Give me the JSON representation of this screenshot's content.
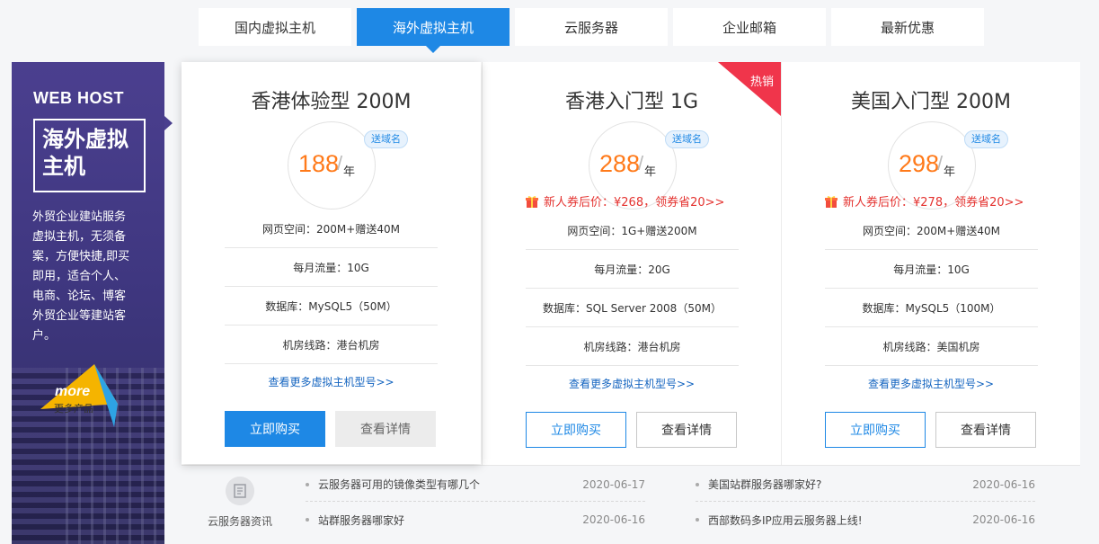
{
  "tabs": [
    "国内虚拟主机",
    "海外虚拟主机",
    "云服务器",
    "企业邮箱",
    "最新优惠"
  ],
  "active_tab": 1,
  "colors": {
    "accent": "#1e88e5",
    "price": "#ff7a1a",
    "coupon": "#e4322f",
    "banner": "#443b88"
  },
  "banner": {
    "en_title": "WEB HOST",
    "cn_title_line1": "海外虚拟",
    "cn_title_line2": "主机",
    "desc_lines": [
      "外贸企业建站服务",
      "虚拟主机，无须备",
      "案，方便快捷,即买",
      "即用，适合个人、",
      "电商、论坛、博客",
      "外贸企业等建站客",
      "户。"
    ],
    "more_en": "more",
    "more_cn": "更多产品"
  },
  "cards": [
    {
      "title": "香港体验型 200M",
      "price": "188",
      "slash": "/",
      "unit": "年",
      "tag": "送域名",
      "coupon": "",
      "specs": [
        "网页空间：200M+赠送40M",
        "每月流量：10G",
        "数据库：MySQL5（50M）",
        "机房线路：港台机房"
      ],
      "more_link": "查看更多虚拟主机型号>>",
      "buy": "立即购买",
      "detail": "查看详情"
    },
    {
      "title": "香港入门型 1G",
      "price": "288",
      "slash": "/",
      "unit": "年",
      "tag": "送域名",
      "coupon": "新人券后价：¥268，领券省20>>",
      "hot": "热销",
      "specs": [
        "网页空间：1G+赠送200M",
        "每月流量：20G",
        "数据库：SQL Server 2008（50M）",
        "机房线路：港台机房"
      ],
      "more_link": "查看更多虚拟主机型号>>",
      "buy": "立即购买",
      "detail": "查看详情"
    },
    {
      "title": "美国入门型 200M",
      "price": "298",
      "slash": "/",
      "unit": "年",
      "tag": "送域名",
      "coupon": "新人券后价：¥278，领券省20>>",
      "specs": [
        "网页空间：200M+赠送40M",
        "每月流量：10G",
        "数据库：MySQL5（100M）",
        "机房线路：美国机房"
      ],
      "more_link": "查看更多虚拟主机型号>>",
      "buy": "立即购买",
      "detail": "查看详情"
    }
  ],
  "news": {
    "label": "云服务器资讯",
    "items": [
      {
        "title": "云服务器可用的镜像类型有哪几个",
        "date": "2020-06-17"
      },
      {
        "title": "美国站群服务器哪家好?",
        "date": "2020-06-16"
      },
      {
        "title": "站群服务器哪家好",
        "date": "2020-06-16"
      },
      {
        "title": "西部数码多IP应用云服务器上线!",
        "date": "2020-06-16"
      }
    ]
  }
}
